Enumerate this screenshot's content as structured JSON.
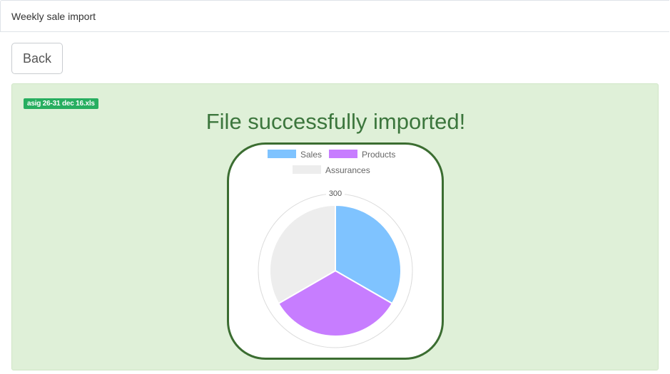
{
  "header": {
    "title": "Weekly sale import"
  },
  "toolbar": {
    "back_label": "Back"
  },
  "file": {
    "name": "asig 26-31 dec 16.xls"
  },
  "message": {
    "success": "File successfully imported!"
  },
  "chart_data": {
    "type": "pie",
    "categories": [
      "Sales",
      "Products",
      "Assurances"
    ],
    "values": [
      100,
      100,
      100
    ],
    "colors": [
      "#7fc3ff",
      "#c77dff",
      "#ededed"
    ],
    "scale_label": "300",
    "legend": "top",
    "title": ""
  },
  "colors": {
    "panel_bg": "#dff0d8",
    "success_text": "#3c763d",
    "badge_bg": "#27ae60",
    "chart_border": "#3b6d31"
  }
}
